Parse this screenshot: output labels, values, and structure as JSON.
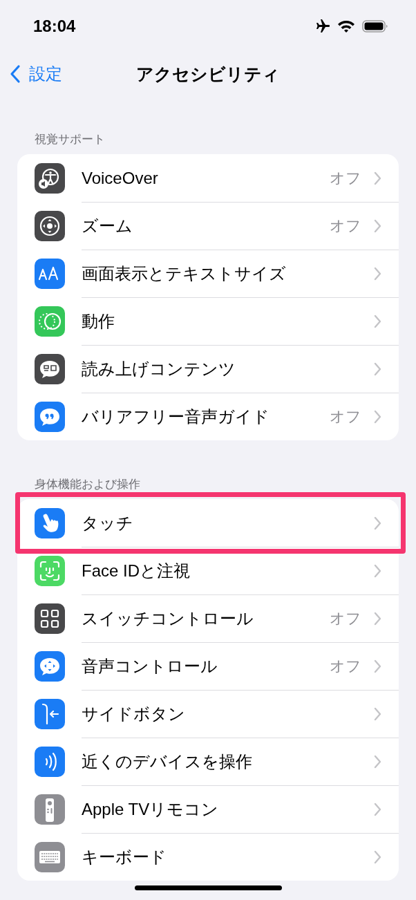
{
  "status_bar": {
    "time": "18:04"
  },
  "nav": {
    "back": "設定",
    "title": "アクセシビリティ"
  },
  "sections": [
    {
      "header": "視覚サポート",
      "items": [
        {
          "label": "VoiceOver",
          "value": "オフ",
          "color": "#48484a",
          "highlighted": false
        },
        {
          "label": "ズーム",
          "value": "オフ",
          "color": "#48484a",
          "highlighted": false
        },
        {
          "label": "画面表示とテキストサイズ",
          "color": "#1a7cf5",
          "highlighted": false
        },
        {
          "label": "動作",
          "color": "#34c759",
          "highlighted": false
        },
        {
          "label": "読み上げコンテンツ",
          "color": "#48484a",
          "highlighted": false
        },
        {
          "label": "バリアフリー音声ガイド",
          "value": "オフ",
          "color": "#1a7cf5",
          "highlighted": false
        }
      ]
    },
    {
      "header": "身体機能および操作",
      "items": [
        {
          "label": "タッチ",
          "color": "#1a7cf5",
          "highlighted": true
        },
        {
          "label": "Face IDと注視",
          "color": "#4cd964",
          "highlighted": false
        },
        {
          "label": "スイッチコントロール",
          "value": "オフ",
          "color": "#48484a",
          "highlighted": false
        },
        {
          "label": "音声コントロール",
          "value": "オフ",
          "color": "#1a7cf5",
          "highlighted": false
        },
        {
          "label": "サイドボタン",
          "color": "#1a7cf5",
          "highlighted": false
        },
        {
          "label": "近くのデバイスを操作",
          "color": "#1a7cf5",
          "highlighted": false
        },
        {
          "label": "Apple TVリモコン",
          "color": "#8e8e93",
          "highlighted": false
        },
        {
          "label": "キーボード",
          "color": "#8e8e93",
          "highlighted": false
        }
      ]
    }
  ]
}
